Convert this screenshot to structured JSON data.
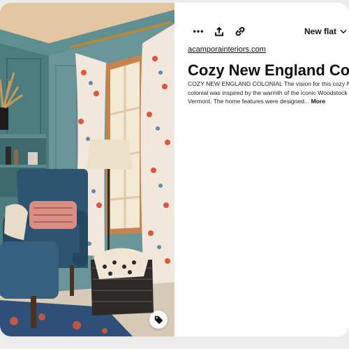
{
  "pin": {
    "image": {
      "description_icon": "tag-icon"
    },
    "toolbar": {
      "more_icon": "ellipsis-icon",
      "share_icon": "share-upload-icon",
      "link_icon": "link-icon",
      "board_label": "New flat",
      "board_icon": "chevron-down-icon"
    },
    "source": "acamporainteriors.com",
    "title": "Cozy New England Colonial",
    "description": "COZY NEW ENGLAND COLONIAL The vision for this cozy New England colonial was inspired by the warmth of the iconic Woodstock Inn in Woodstock, Vermont. The home features were designed...",
    "more_label": "More"
  },
  "colors": {
    "text": "#111111",
    "background": "#ffffff",
    "page_gray": "#ececec"
  }
}
